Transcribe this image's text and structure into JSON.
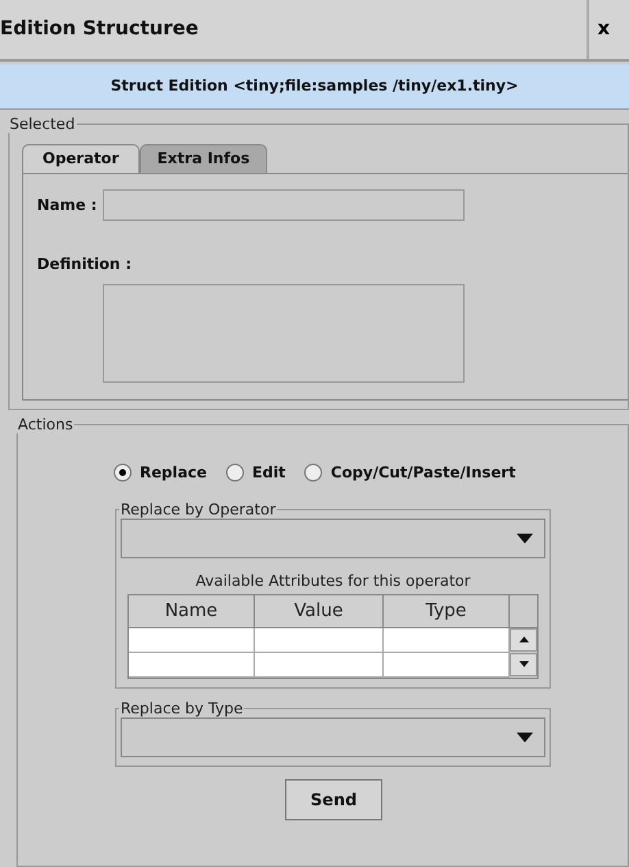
{
  "window": {
    "title": "Edition Structuree",
    "close": "x"
  },
  "header": "Struct Edition <tiny;file:samples /tiny/ex1.tiny>",
  "selected_group": {
    "legend": "Selected",
    "tabs": [
      {
        "label": "Operator",
        "selected": true
      },
      {
        "label": "Extra Infos",
        "selected": false
      }
    ],
    "name_label": "Name :",
    "definition_label": "Definition :"
  },
  "actions_group": {
    "legend": "Actions",
    "modes": [
      {
        "label": "Replace",
        "selected": true
      },
      {
        "label": "Edit",
        "selected": false
      },
      {
        "label": "Copy/Cut/Paste/Insert",
        "selected": false
      }
    ],
    "operator_group": {
      "legend": "Replace by Operator",
      "caption": "Available Attributes for this operator",
      "columns": [
        "Name",
        "Value",
        "Type"
      ]
    },
    "type_group": {
      "legend": "Replace by Type"
    },
    "send": "Send"
  }
}
